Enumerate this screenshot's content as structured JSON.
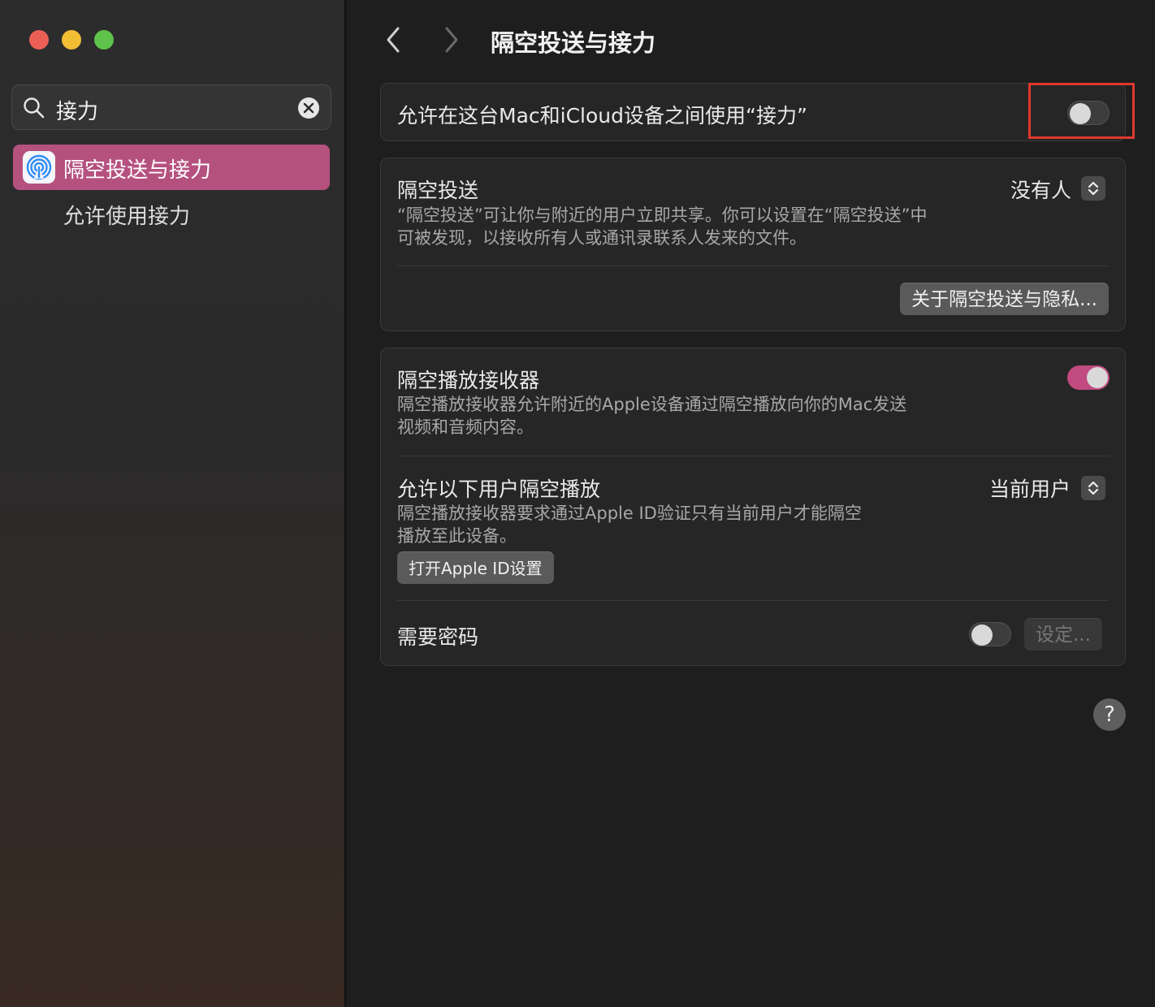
{
  "window": {
    "title": "隔空投送与接力"
  },
  "sidebar": {
    "search": {
      "value": "接力"
    },
    "items": [
      {
        "label": "隔空投送与接力",
        "selected": true,
        "icon": "airdrop-icon"
      },
      {
        "label": "允许使用接力",
        "selected": false
      }
    ]
  },
  "handoff": {
    "label": "允许在这台Mac和iCloud设备之间使用“接力”",
    "enabled": false
  },
  "airdrop": {
    "title": "隔空投送",
    "description_line1": "“隔空投送”可让你与附近的用户立即共享。你可以设置在“隔空投送”中",
    "description_line2": "可被发现，以接收所有人或通讯录联系人发来的文件。",
    "selected": "没有人",
    "privacy_button": "关于隔空投送与隐私..."
  },
  "airplay": {
    "title": "隔空播放接收器",
    "enabled": true,
    "description_line1": "隔空播放接收器允许附近的Apple设备通过隔空播放向你的Mac发送",
    "description_line2": "视频和音频内容。",
    "allow_title": "允许以下用户隔空播放",
    "allow_selected": "当前用户",
    "allow_desc_line1": "隔空播放接收器要求通过Apple ID验证只有当前用户才能隔空",
    "allow_desc_line2": "播放至此设备。",
    "apple_id_button": "打开Apple ID设置",
    "password_label": "需要密码",
    "password_enabled": false,
    "set_button": "设定..."
  },
  "help": {
    "label": "?"
  },
  "colors": {
    "accent": "#c14b80",
    "sidebar_selected": "#b5517f",
    "highlight_box": "#e0392f"
  }
}
